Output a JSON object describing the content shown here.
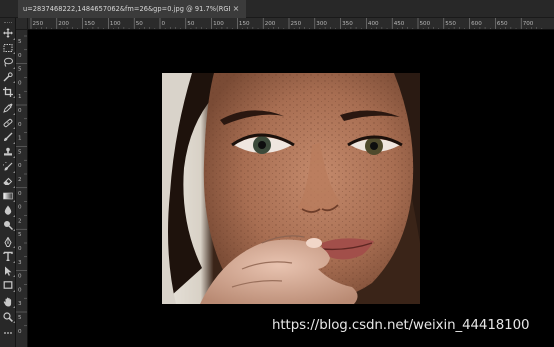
{
  "document_tab": {
    "title": "u=2837468222,1484657062&fm=26&gp=0.jpg @ 91.7%(RGB/8#)",
    "close_glyph": "×"
  },
  "ruler": {
    "horizontal_labels": [
      "250",
      "200",
      "150",
      "100",
      "50",
      "0",
      "50",
      "100",
      "150",
      "200",
      "250",
      "300",
      "350",
      "400",
      "450",
      "500",
      "550",
      "600",
      "650",
      "700"
    ],
    "vertical_labels": [
      "5",
      "0",
      "5",
      "0",
      "1",
      "0",
      "0",
      "1",
      "5",
      "0",
      "2",
      "0",
      "0",
      "2",
      "5",
      "0",
      "3",
      "0",
      "0",
      "3",
      "5",
      "0"
    ]
  },
  "tools": [
    {
      "name": "move-tool",
      "icon": "move-icon"
    },
    {
      "name": "marquee-tool",
      "icon": "marquee-icon"
    },
    {
      "name": "lasso-tool",
      "icon": "lasso-icon"
    },
    {
      "name": "quick-select-tool",
      "icon": "quick-select-icon"
    },
    {
      "name": "crop-tool",
      "icon": "crop-icon"
    },
    {
      "name": "eyedropper-tool",
      "icon": "eyedropper-icon"
    },
    {
      "name": "healing-brush-tool",
      "icon": "bandage-icon"
    },
    {
      "name": "brush-tool",
      "icon": "brush-icon"
    },
    {
      "name": "clone-stamp-tool",
      "icon": "stamp-icon"
    },
    {
      "name": "history-brush-tool",
      "icon": "history-brush-icon"
    },
    {
      "name": "eraser-tool",
      "icon": "eraser-icon"
    },
    {
      "name": "gradient-tool",
      "icon": "gradient-icon"
    },
    {
      "name": "blur-tool",
      "icon": "blur-icon"
    },
    {
      "name": "dodge-tool",
      "icon": "dodge-icon"
    },
    {
      "name": "pen-tool",
      "icon": "pen-icon"
    },
    {
      "name": "type-tool",
      "icon": "type-icon",
      "glyph": "T"
    },
    {
      "name": "path-select-tool",
      "icon": "arrow-icon"
    },
    {
      "name": "shape-tool",
      "icon": "rectangle-icon"
    },
    {
      "name": "hand-tool",
      "icon": "hand-icon"
    },
    {
      "name": "zoom-tool",
      "icon": "zoom-icon"
    },
    {
      "name": "more-tools",
      "icon": "ellipsis-icon"
    }
  ],
  "watermark": "https://blog.csdn.net/weixin_44418100",
  "colors": {
    "app_background": "#000000",
    "panel": "#282828",
    "tab_active": "#3b3b3b",
    "ruler": "#2b2b2b",
    "icon": "#c9c9c9"
  }
}
